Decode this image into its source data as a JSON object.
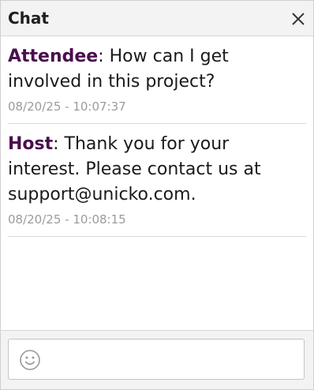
{
  "header": {
    "title": "Chat"
  },
  "messages": [
    {
      "sender": "Attendee",
      "text": ": How can I get involved in this project?",
      "timestamp": "08/20/25 - 10:07:37"
    },
    {
      "sender": "Host",
      "text": ": Thank you for your interest. Please contact us at support@unicko.com.",
      "timestamp": "08/20/25 - 10:08:15"
    }
  ],
  "input": {
    "value": "",
    "placeholder": ""
  },
  "icons": {
    "close": "close-icon",
    "emoji": "smiley-icon"
  },
  "colors": {
    "sender": "#4a0f4f",
    "timestamp": "#9b9b9b",
    "header_bg": "#f3f3f3"
  }
}
